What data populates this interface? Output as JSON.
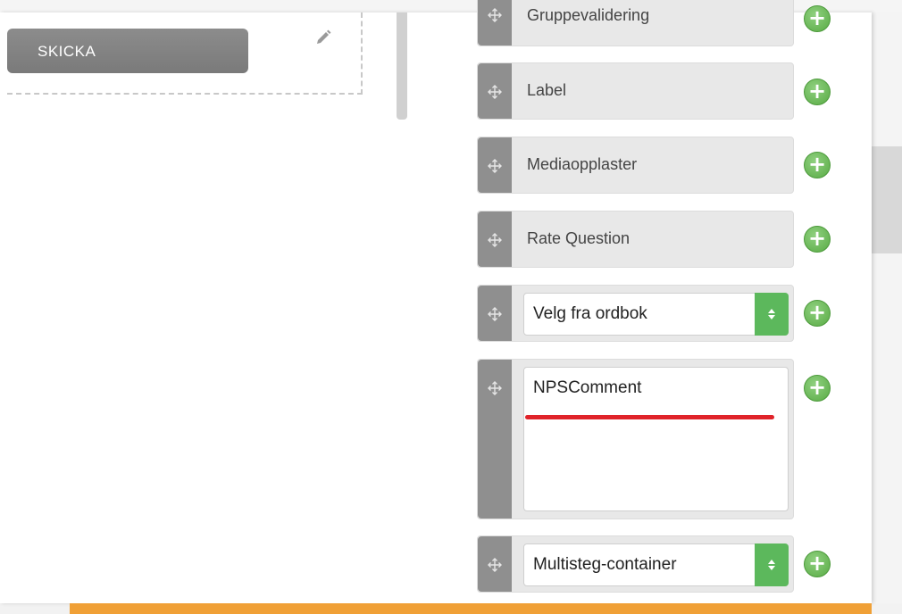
{
  "preview": {
    "submit_label": "SKICKA"
  },
  "palette": {
    "items": [
      {
        "label": "Gruppevalidering",
        "kind": "text"
      },
      {
        "label": "Label",
        "kind": "text"
      },
      {
        "label": "Mediaopplaster",
        "kind": "text"
      },
      {
        "label": "Rate Question",
        "kind": "text"
      },
      {
        "value": "Velg fra ordbok",
        "kind": "select"
      },
      {
        "value": "NPSComment",
        "kind": "textarea"
      },
      {
        "value": "Multisteg-container",
        "kind": "select"
      }
    ]
  },
  "icons": {
    "drag": "move-icon",
    "add": "plus-icon",
    "edit": "pencil-icon",
    "select_caret": "updown-caret-icon"
  },
  "colors": {
    "add_green": "#5cb85c",
    "handle_gray": "#8f8f8f",
    "underline_red": "#e0232a",
    "orange_bar": "#f0a036"
  }
}
